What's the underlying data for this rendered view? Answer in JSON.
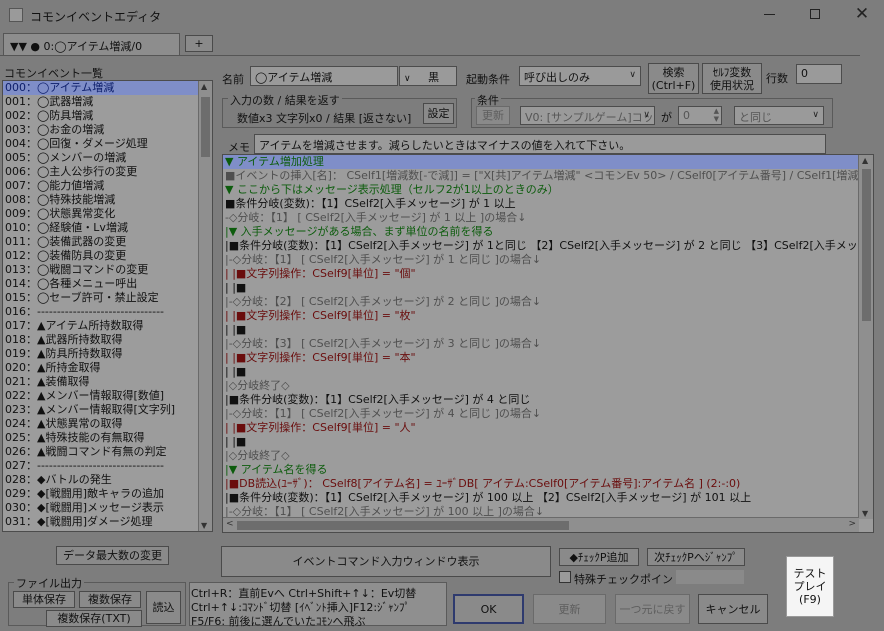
{
  "window": {
    "title": "コモンイベントエディタ",
    "icon": "app-icon"
  },
  "tabs": [
    {
      "label": "▼▼ ● 0:◯アイテム増減/0"
    }
  ],
  "tab_add_label": "+",
  "list_header": "コモンイベント一覧",
  "event_list": [
    "000：◯アイテム増減",
    "001：◯武器増減",
    "002：◯防具増減",
    "003：◯お金の増減",
    "004：◯回復・ダメージ処理",
    "005：◯メンバーの増減",
    "006：◯主人公歩行の変更",
    "007：◯能力値増減",
    "008：◯特殊技能増減",
    "009：◯状態異常変化",
    "010：◯経験値・Lv増減",
    "011：◯装備武器の変更",
    "012：◯装備防具の変更",
    "013：◯戦闘コマンドの変更",
    "014：◯各種メニュー呼出",
    "015：◯セーブ許可・禁止設定",
    "016：--------------------------------",
    "017：▲アイテム所持数取得",
    "018：▲武器所持数取得",
    "019：▲防具所持数取得",
    "020：▲所持金取得",
    "021：▲装備取得",
    "022：▲メンバー情報取得[数値]",
    "023：▲メンバー情報取得[文字列]",
    "024：▲状態異常の取得",
    "025：▲特殊技能の有無取得",
    "026：▲戦闘コマンド有無の判定",
    "027：--------------------------------",
    "028：◆バトルの発生",
    "029：◆[戦闘用]敵キャラの追加",
    "030：◆[戦闘用]メッセージ表示",
    "031：◆[戦闘用]ダメージ処理"
  ],
  "name_label": "名前",
  "name_value": "◯アイテム増減",
  "color_value": "黒",
  "trigger_label": "起動条件",
  "trigger_value": "呼び出しのみ",
  "search_button": "検索\n(Ctrl+F)",
  "self_var_button": "ｾﾙﾌ変数\n使用状況",
  "line_count_label": "行数",
  "line_count_value": "0",
  "io_group_label": "入力の数 / 結果を返す",
  "io_summary": "数値x3 文字列x0 / 結果 [返さない]",
  "io_settings_button": "設定",
  "condition_group_label": "条件",
  "update_button": "更新",
  "condition_var_value": "V0: [サンプルゲーム]コッ",
  "condition_ga": "が",
  "condition_num_value": "0",
  "condition_op_value": "と同じ",
  "memo_label": "メモ",
  "memo_value": "アイテムを増減させます。減らしたいときはマイナスの値を入れて下さい。",
  "event_lines": [
    {
      "text": "▼ アイテム増加処理",
      "color": "green",
      "hl": true
    },
    {
      "text": "■イベントの挿入[名]： CSelf1[増減数[-で減]] = [\"X[共]アイテム増減\" <コモンEv 50>  / CSelf0[アイテム番号] / CSelf1[増減数[-",
      "color": "gray"
    },
    {
      "text": "▼ ここから下はメッセージ表示処理（セルフ2が1以上のときのみ）",
      "color": "green"
    },
    {
      "text": "■条件分岐(変数)：【1】CSelf2[入手メッセージ]  が  1 以上",
      "color": "dark"
    },
    {
      "text": "-◇分岐：【1】 [ CSelf2[入手メッセージ]  が  1 以上 ]の場合↓",
      "color": "gray"
    },
    {
      "text": "|▼ 入手メッセージがある場合、まず単位の名前を得る",
      "color": "green"
    },
    {
      "text": "|■条件分岐(変数)：【1】CSelf2[入手メッセージ]  が  1と同じ 【2】CSelf2[入手メッセージ]  が  2 と同じ 【3】CSelf2[入手メッセー",
      "color": "dark"
    },
    {
      "text": "|-◇分岐：【1】 [ CSelf2[入手メッセージ]  が  1 と同じ ]の場合↓",
      "color": "gray"
    },
    {
      "text": "| |■文字列操作：CSelf9[単位] = \"個\"",
      "color": "red"
    },
    {
      "text": "| |■",
      "color": "dark"
    },
    {
      "text": "|-◇分岐：【2】 [ CSelf2[入手メッセージ]  が  2 と同じ ]の場合↓",
      "color": "gray"
    },
    {
      "text": "| |■文字列操作：CSelf9[単位] = \"枚\"",
      "color": "red"
    },
    {
      "text": "| |■",
      "color": "dark"
    },
    {
      "text": "|-◇分岐：【3】 [ CSelf2[入手メッセージ]  が  3 と同じ ]の場合↓",
      "color": "gray"
    },
    {
      "text": "| |■文字列操作：CSelf9[単位] = \"本\"",
      "color": "red"
    },
    {
      "text": "| |■",
      "color": "dark"
    },
    {
      "text": "|◇分岐終了◇",
      "color": "gray"
    },
    {
      "text": "|■条件分岐(変数)：【1】CSelf2[入手メッセージ]  が  4 と同じ",
      "color": "dark"
    },
    {
      "text": "|-◇分岐：【1】 [ CSelf2[入手メッセージ]  が  4 と同じ ]の場合↓",
      "color": "gray"
    },
    {
      "text": "| |■文字列操作：CSelf9[単位] = \"人\"",
      "color": "red"
    },
    {
      "text": "| |■",
      "color": "dark"
    },
    {
      "text": "|◇分岐終了◇",
      "color": "gray"
    },
    {
      "text": "|▼ アイテム名を得る",
      "color": "green"
    },
    {
      "text": "|■DB読込(ﾕｰｻﾞ)： CSelf8[アイテム名] = ﾕｰｻﾞDB[ アイテム:CSelf0[アイテム番号]:アイテム名 ] (2:-:0)",
      "color": "red"
    },
    {
      "text": "|■条件分岐(変数)：【1】CSelf2[入手メッセージ]  が  100 以上 【2】CSelf2[入手メッセージ]  が  101 以上",
      "color": "dark"
    },
    {
      "text": "|-◇分岐：【1】 [ CSelf2[入手メッセージ]  が  100 以上 ]の場合↓",
      "color": "gray"
    }
  ],
  "data_max_button": "データ最大数の変更",
  "command_window_button": "イベントコマンド入力ウィンドウ表示",
  "checkpoint_add_button": "◆ﾁｪｯｸP追加",
  "checkpoint_jump_button": "次ﾁｪｯｸPへｼﾞｬﾝﾌﾟ",
  "special_checkpoint_label": "特殊チェックポイント",
  "file_output_label": "ファイル出力",
  "single_save_button": "単体保存",
  "multi_save_button": "複数保存",
  "multi_save_txt_button": "複数保存(TXT)",
  "load_button": "読込",
  "help_lines": [
    "Ctrl+R：直前Evへ  Ctrl+Shift+↑↓：Ev切替",
    "Ctrl+↑↓:ｺﾏﾝﾄﾞ切替 [ｲﾍﾞﾝﾄ挿入]F12:ｼﾞｬﾝﾌﾟ",
    "F5/F6: 前後に選んでいたｺﾓﾝへ飛ぶ"
  ],
  "ok_button": "OK",
  "apply_button": "更新",
  "undo_button": "一つ元に戻す",
  "cancel_button": "キャンセル",
  "test_play_button": "テスト\nプレイ\n(F9)",
  "colors": {
    "green": "#0d5c0d",
    "gray": "#4f4f4f",
    "dark": "#111111",
    "red": "#6a0d0d",
    "selection": "#7f8ec8",
    "background": "#7d7d7d"
  }
}
